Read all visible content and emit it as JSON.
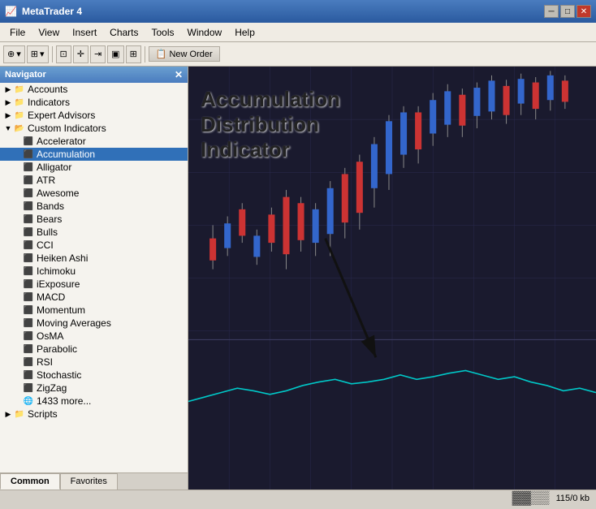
{
  "titleBar": {
    "title": "MetaTrader 4",
    "iconSymbol": "📈"
  },
  "menuBar": {
    "items": [
      "File",
      "View",
      "Insert",
      "Charts",
      "Tools",
      "Window",
      "Help"
    ]
  },
  "toolbar": {
    "newOrderLabel": "New Order"
  },
  "navigator": {
    "title": "Navigator",
    "items": [
      {
        "id": "accounts",
        "label": "Accounts",
        "indent": 0,
        "type": "folder",
        "expanded": false
      },
      {
        "id": "indicators",
        "label": "Indicators",
        "indent": 0,
        "type": "folder",
        "expanded": false
      },
      {
        "id": "expert-advisors",
        "label": "Expert Advisors",
        "indent": 0,
        "type": "folder",
        "expanded": false
      },
      {
        "id": "custom-indicators",
        "label": "Custom Indicators",
        "indent": 0,
        "type": "folder",
        "expanded": true
      },
      {
        "id": "accelerator",
        "label": "Accelerator",
        "indent": 1,
        "type": "indicator"
      },
      {
        "id": "accumulation",
        "label": "Accumulation",
        "indent": 1,
        "type": "indicator",
        "selected": true
      },
      {
        "id": "alligator",
        "label": "Alligator",
        "indent": 1,
        "type": "indicator"
      },
      {
        "id": "atr",
        "label": "ATR",
        "indent": 1,
        "type": "indicator"
      },
      {
        "id": "awesome",
        "label": "Awesome",
        "indent": 1,
        "type": "indicator"
      },
      {
        "id": "bands",
        "label": "Bands",
        "indent": 1,
        "type": "indicator"
      },
      {
        "id": "bears",
        "label": "Bears",
        "indent": 1,
        "type": "indicator"
      },
      {
        "id": "bulls",
        "label": "Bulls",
        "indent": 1,
        "type": "indicator"
      },
      {
        "id": "cci",
        "label": "CCI",
        "indent": 1,
        "type": "indicator"
      },
      {
        "id": "heiken-ashi",
        "label": "Heiken Ashi",
        "indent": 1,
        "type": "indicator"
      },
      {
        "id": "ichimoku",
        "label": "Ichimoku",
        "indent": 1,
        "type": "indicator"
      },
      {
        "id": "iexposure",
        "label": "iExposure",
        "indent": 1,
        "type": "indicator"
      },
      {
        "id": "macd",
        "label": "MACD",
        "indent": 1,
        "type": "indicator"
      },
      {
        "id": "momentum",
        "label": "Momentum",
        "indent": 1,
        "type": "indicator"
      },
      {
        "id": "moving-averages",
        "label": "Moving Averages",
        "indent": 1,
        "type": "indicator"
      },
      {
        "id": "osma",
        "label": "OsMA",
        "indent": 1,
        "type": "indicator"
      },
      {
        "id": "parabolic",
        "label": "Parabolic",
        "indent": 1,
        "type": "indicator"
      },
      {
        "id": "rsi",
        "label": "RSI",
        "indent": 1,
        "type": "indicator"
      },
      {
        "id": "stochastic",
        "label": "Stochastic",
        "indent": 1,
        "type": "indicator"
      },
      {
        "id": "zigzag",
        "label": "ZigZag",
        "indent": 1,
        "type": "indicator"
      },
      {
        "id": "more",
        "label": "1433 more...",
        "indent": 1,
        "type": "more"
      },
      {
        "id": "scripts",
        "label": "Scripts",
        "indent": 0,
        "type": "folder",
        "expanded": false
      }
    ]
  },
  "annotation": {
    "line1": "Accumulation",
    "line2": "Distribution",
    "line3": "Indicator"
  },
  "tabs": {
    "items": [
      "Common",
      "Favorites"
    ],
    "active": "Common"
  },
  "statusBar": {
    "memoryIndicator": "▓▓▒▒",
    "memoryText": "115/0 kb"
  }
}
